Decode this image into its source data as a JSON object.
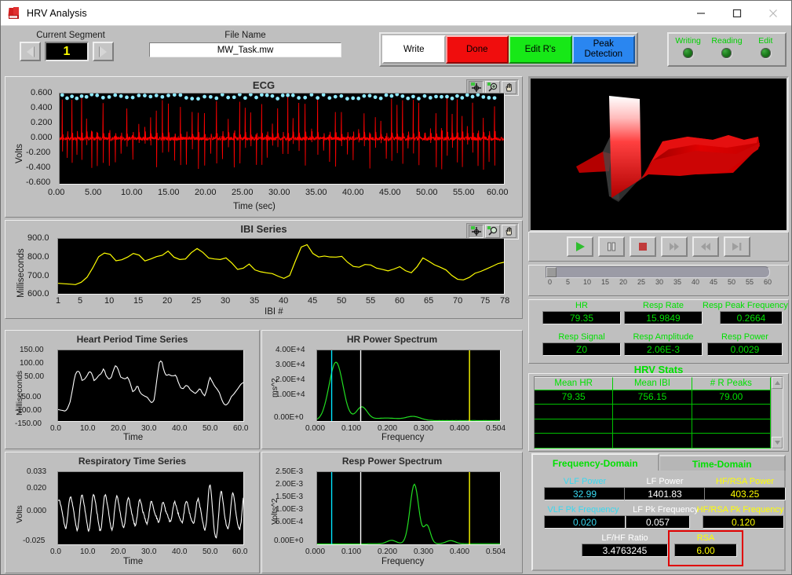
{
  "window": {
    "title": "HRV Analysis",
    "icon": "hrv-app-icon",
    "minimize": "minimize-icon",
    "maximize": "maximize-icon",
    "close": "close-icon"
  },
  "toolbar": {
    "segment_label": "Current Segment",
    "segment_value": "1",
    "prev_segment": "previous-arrow",
    "next_segment": "next-arrow",
    "file_label": "File Name",
    "file_value": "MW_Task.mw",
    "buttons": [
      {
        "label": "Write",
        "color": "#ffffff",
        "text_color": "#000000"
      },
      {
        "label": "Done",
        "color": "#f00d0d",
        "text_color": "#000000"
      },
      {
        "label": "Edit R's",
        "color": "#17e817",
        "text_color": "#000000"
      },
      {
        "label": "Peak Detection",
        "color": "#2a86f0",
        "text_color": "#000000"
      }
    ],
    "leds": [
      {
        "label": "Writing",
        "state": "off"
      },
      {
        "label": "Reading",
        "state": "off"
      },
      {
        "label": "Edit",
        "state": "off"
      }
    ]
  },
  "graph_tools": {
    "cursor": "crosshair-icon",
    "zoom": "magnifier-icon",
    "pan": "hand-icon"
  },
  "chart_data": [
    {
      "id": "ecg",
      "type": "line",
      "title": "ECG",
      "xlabel": "Time (sec)",
      "ylabel": "Volts",
      "xlim": [
        0,
        60
      ],
      "ylim": [
        -0.6,
        0.6
      ],
      "xticks": [
        "0.00",
        "5.00",
        "10.00",
        "15.00",
        "20.00",
        "25.00",
        "30.00",
        "35.00",
        "40.00",
        "45.00",
        "50.00",
        "55.00",
        "60.00"
      ],
      "yticks": [
        "0.600",
        "0.400",
        "0.200",
        "0.000",
        "-0.200",
        "-0.400",
        "-0.600"
      ],
      "series": [
        {
          "name": "ECG signal",
          "color": "#ff0000",
          "description": "Raw ECG waveform, ~79 R-peaks over 60 s"
        },
        {
          "name": "R-peak markers",
          "color": "#7fe8ff",
          "style": "points",
          "description": "Detected R peaks plotted near 0.55 V"
        }
      ],
      "grid": false
    },
    {
      "id": "ibi",
      "type": "line",
      "title": "IBI Series",
      "xlabel": "IBI #",
      "ylabel": "Milliseconds",
      "xlim": [
        1,
        78
      ],
      "ylim": [
        600,
        900
      ],
      "xticks": [
        "1",
        "5",
        "10",
        "15",
        "20",
        "25",
        "30",
        "35",
        "40",
        "45",
        "50",
        "55",
        "60",
        "65",
        "70",
        "75",
        "78"
      ],
      "yticks": [
        "900.0",
        "800.0",
        "700.0",
        "600.0"
      ],
      "series": [
        {
          "name": "IBI",
          "color": "#ffff00",
          "values": [
            657,
            655,
            653,
            650,
            663,
            690,
            742,
            802,
            822,
            815,
            780,
            786,
            800,
            820,
            811,
            779,
            790,
            803,
            810,
            833,
            800,
            787,
            790,
            824,
            847,
            826,
            795,
            790,
            787,
            796,
            768,
            733,
            740,
            762,
            730,
            720,
            714,
            710,
            696,
            684,
            700,
            780,
            855,
            868,
            820,
            801,
            806,
            801,
            800,
            804,
            772,
            749,
            745,
            760,
            757,
            740,
            733,
            725,
            735,
            748,
            726,
            715,
            748,
            796,
            778,
            758,
            745,
            730,
            700,
            679,
            676,
            689,
            712,
            722,
            736,
            750,
            765,
            772
          ]
        }
      ],
      "grid": false
    },
    {
      "id": "heart-period",
      "type": "line",
      "title": "Heart Period Time Series",
      "xlabel": "Time",
      "ylabel": "Milliseconds",
      "xlim": [
        0,
        60
      ],
      "ylim": [
        -150,
        150
      ],
      "xticks": [
        "0.0",
        "10.0",
        "20.0",
        "30.0",
        "40.0",
        "50.0",
        "60.0"
      ],
      "yticks": [
        "150.00",
        "100.00",
        "50.00",
        "-50.00",
        "-100.00",
        "-150.00"
      ],
      "series": [
        {
          "name": "Heart period deviation",
          "color": "#ffffff"
        }
      ],
      "grid": false
    },
    {
      "id": "hr-power-spectrum",
      "type": "line",
      "title": "HR Power Spectrum",
      "xlabel": "Frequency",
      "ylabel": "ms^2",
      "xlim": [
        0,
        0.504
      ],
      "ylim": [
        0,
        40000
      ],
      "xticks": [
        "0.000",
        "0.100",
        "0.200",
        "0.300",
        "0.400",
        "0.504"
      ],
      "yticks": [
        "4.00E+4",
        "3.00E+4",
        "2.00E+4",
        "1.00E+4",
        "0.00E+0"
      ],
      "series": [
        {
          "name": "HR spectrum",
          "color": "#22e022",
          "peak_value": 33000,
          "peak_frequency": 0.05
        }
      ],
      "cursors": [
        {
          "name": "VLF cursor",
          "color": "#00e5ff",
          "frequency": 0.04
        },
        {
          "name": "LF cursor",
          "color": "#ffffff",
          "frequency": 0.12
        },
        {
          "name": "HF cursor",
          "color": "#ffff00",
          "frequency": 0.42
        }
      ],
      "grid": false
    },
    {
      "id": "respiratory-time-series",
      "type": "line",
      "title": "Respiratory Time Series",
      "xlabel": "Time",
      "ylabel": "Volts",
      "xlim": [
        0,
        60
      ],
      "ylim": [
        -0.025,
        0.033
      ],
      "xticks": [
        "0.0",
        "10.0",
        "20.0",
        "30.0",
        "40.0",
        "50.0",
        "60.0"
      ],
      "yticks": [
        "0.033",
        "0.020",
        "0.000",
        "-0.025"
      ],
      "series": [
        {
          "name": "Respiration",
          "color": "#ffffff",
          "description": "~16 breaths per minute oscillation"
        }
      ],
      "grid": false
    },
    {
      "id": "resp-power-spectrum",
      "type": "line",
      "title": "Resp Power Spectrum",
      "xlabel": "Frequency",
      "ylabel": "Volts^2",
      "xlim": [
        0,
        0.504
      ],
      "ylim": [
        0,
        0.0025
      ],
      "xticks": [
        "0.000",
        "0.100",
        "0.200",
        "0.300",
        "0.400",
        "0.504"
      ],
      "yticks": [
        "2.50E-3",
        "2.00E-3",
        "1.50E-3",
        "1.00E-3",
        "5.00E-4",
        "0.00E+0"
      ],
      "series": [
        {
          "name": "Resp spectrum",
          "color": "#22e022",
          "peak_value": 0.00206,
          "peak_frequency": 0.2664
        }
      ],
      "cursors": [
        {
          "name": "VLF cursor",
          "color": "#00e5ff",
          "frequency": 0.04
        },
        {
          "name": "LF cursor",
          "color": "#ffffff",
          "frequency": 0.12
        },
        {
          "name": "HF cursor",
          "color": "#ffff00",
          "frequency": 0.42
        }
      ],
      "grid": false
    },
    {
      "id": "ecg-3d-surface",
      "type": "surface",
      "title": "",
      "description": "3D waterfall surface of stacked ECG beats rendered in red on black",
      "series": [
        {
          "name": "ECG surface",
          "color": "#e00000"
        }
      ]
    }
  ],
  "media_controls": [
    {
      "name": "play",
      "glyph": "play-icon",
      "enabled": true
    },
    {
      "name": "pause",
      "glyph": "pause-icon",
      "enabled": true
    },
    {
      "name": "stop",
      "glyph": "stop-icon",
      "enabled": true
    },
    {
      "name": "forward",
      "glyph": "fast-forward-icon",
      "enabled": false
    },
    {
      "name": "rewind",
      "glyph": "rewind-icon",
      "enabled": false
    },
    {
      "name": "skip-end",
      "glyph": "skip-to-end-icon",
      "enabled": false
    }
  ],
  "time_slider": {
    "value": 0,
    "min": 0,
    "max": 60,
    "ticks": [
      "0",
      "5",
      "10",
      "15",
      "20",
      "25",
      "30",
      "35",
      "40",
      "45",
      "50",
      "55",
      "60"
    ]
  },
  "readouts": [
    {
      "label": "HR",
      "value": "79.35"
    },
    {
      "label": "Resp Rate",
      "value": "15.9849"
    },
    {
      "label": "Resp Peak Frequency",
      "value": "0.2664"
    },
    {
      "label": "Resp Signal",
      "value": "Z0"
    },
    {
      "label": "Resp Amplitude",
      "value": "2.06E-3"
    },
    {
      "label": "Resp Power",
      "value": "0.0029"
    }
  ],
  "hrv_stats": {
    "title": "HRV Stats",
    "columns": [
      "Mean HR",
      "Mean IBI",
      "# R Peaks"
    ],
    "rows": [
      [
        "79.35",
        "756.15",
        "79.00"
      ],
      [
        "",
        "",
        ""
      ],
      [
        "",
        "",
        ""
      ],
      [
        "",
        "",
        ""
      ]
    ],
    "scroll_up": "scroll-up-arrow",
    "scroll_down": "scroll-down-arrow"
  },
  "domain_tabs": {
    "tabs": [
      {
        "label": "Frequency-Domain",
        "active": true
      },
      {
        "label": "Time-Domain",
        "active": false
      }
    ],
    "fields": [
      {
        "label": "VLF  Power",
        "value": "32.99",
        "color": "#38d8f0"
      },
      {
        "label": "LF Power",
        "value": "1401.83",
        "color": "#ffffff"
      },
      {
        "label": "HF/RSA Power",
        "value": "403.25",
        "color": "#ffff00"
      },
      {
        "label": "VLF Pk Frequency",
        "value": "0.020",
        "color": "#38d8f0"
      },
      {
        "label": "LF Pk Frequency",
        "value": "0.057",
        "color": "#ffffff"
      },
      {
        "label": "HF/RSA Pk Frequency",
        "value": "0.120",
        "color": "#ffff00"
      },
      {
        "label": "LF/HF Ratio",
        "value": "3.4763245",
        "color": "#ffffff"
      },
      {
        "label": "RSA",
        "value": "6.00",
        "color": "#ffff00",
        "highlight": "#e00000"
      }
    ]
  }
}
